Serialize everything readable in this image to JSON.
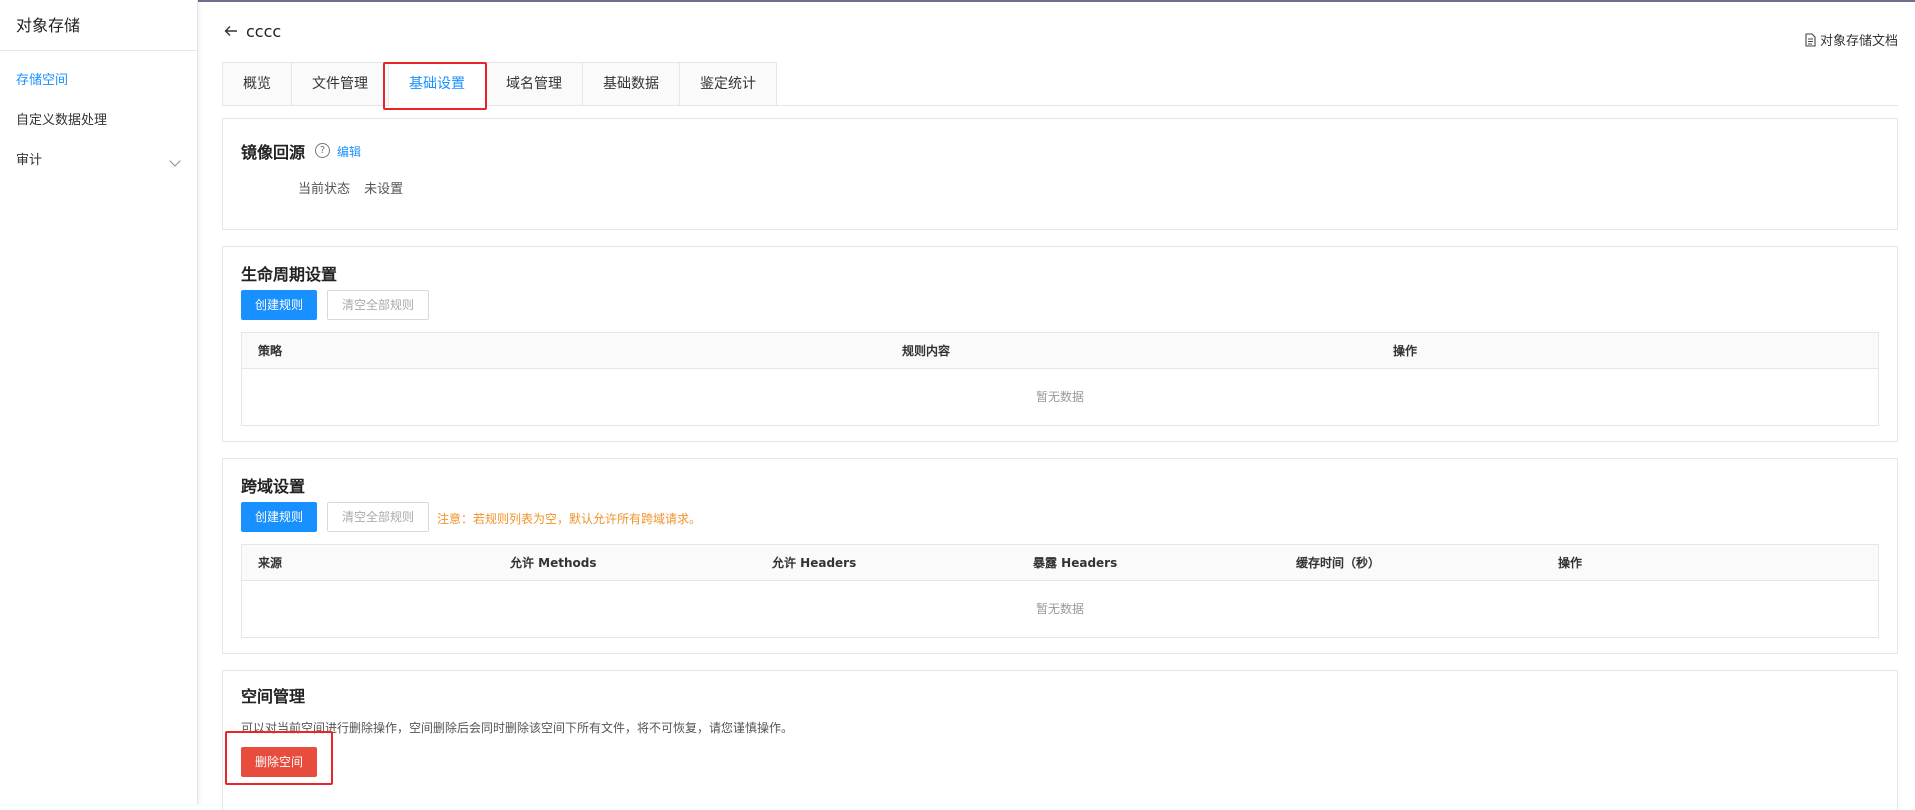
{
  "sidebar": {
    "title": "对象存储",
    "items": [
      {
        "label": "存储空间"
      },
      {
        "label": "自定义数据处理"
      },
      {
        "label": "审计"
      }
    ]
  },
  "header": {
    "bucket_name": "cccc",
    "doc_link": "对象存储文档"
  },
  "tabs": [
    {
      "label": "概览"
    },
    {
      "label": "文件管理"
    },
    {
      "label": "基础设置"
    },
    {
      "label": "域名管理"
    },
    {
      "label": "基础数据"
    },
    {
      "label": "鉴定统计"
    }
  ],
  "mirror": {
    "title": "镜像回源",
    "help": "?",
    "edit": "编辑",
    "status_label": "当前状态",
    "status_value": "未设置"
  },
  "lifecycle": {
    "title": "生命周期设置",
    "create_btn": "创建规则",
    "clear_btn": "清空全部规则",
    "columns": [
      "策略",
      "规则内容",
      "操作"
    ],
    "empty": "暂无数据"
  },
  "cors": {
    "title": "跨域设置",
    "create_btn": "创建规则",
    "clear_btn": "清空全部规则",
    "notice": "注意：若规则列表为空，默认允许所有跨域请求。",
    "columns": [
      "来源",
      "允许 Methods",
      "允许 Headers",
      "暴露 Headers",
      "缓存时间（秒）",
      "操作"
    ],
    "empty": "暂无数据"
  },
  "space": {
    "title": "空间管理",
    "desc": "可以对当前空间进行删除操作，空间删除后会同时删除该空间下所有文件，将不可恢复，请您谨慎操作。",
    "delete_btn": "删除空间"
  },
  "colors": {
    "accent": "#1890ff",
    "danger": "#e84c3d",
    "highlight": "#e8262a",
    "notice": "#f0932b"
  }
}
